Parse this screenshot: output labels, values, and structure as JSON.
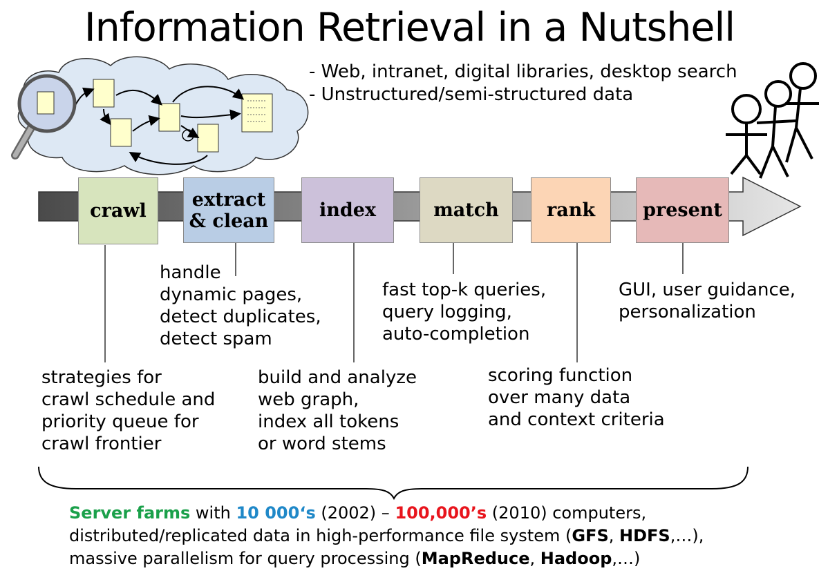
{
  "title": "Information Retrieval in a Nutshell",
  "bullets": [
    "- Web, intranet, digital libraries, desktop search",
    "- Unstructured/semi-structured data"
  ],
  "stages": {
    "crawl": {
      "label": "crawl",
      "color": "#d7e4bd"
    },
    "extract": {
      "line1": "extract",
      "line2": "& clean",
      "color": "#b9cde5"
    },
    "index": {
      "label": "index",
      "color": "#ccc1da"
    },
    "match": {
      "label": "match",
      "color": "#ddd9c3"
    },
    "rank": {
      "label": "rank",
      "color": "#fcd5b5"
    },
    "present": {
      "label": "present",
      "color": "#e6b9b8"
    }
  },
  "descriptions": {
    "extract": [
      "handle",
      "dynamic pages,",
      "detect duplicates,",
      "detect spam"
    ],
    "match": [
      "fast top-k queries,",
      "query logging,",
      "auto-completion"
    ],
    "present": [
      "GUI, user guidance,",
      "personalization"
    ],
    "crawl": [
      "strategies for",
      "crawl schedule and",
      "priority queue for",
      "crawl frontier"
    ],
    "index": [
      "build and analyze",
      "web graph,",
      "index all tokens",
      "or word stems"
    ],
    "rank": [
      "scoring function",
      "over many data",
      "and context criteria"
    ]
  },
  "footer": {
    "line1": {
      "server_farms": "Server farms",
      "with": " with ",
      "ten_k": "10 000‘s",
      "y2002": " (2002) – ",
      "hundred_k": "100,000’s",
      "y2010": " (2010) computers,"
    },
    "line2": {
      "pre": "distributed/replicated data in high-performance file system (",
      "gfs": "GFS",
      "sep": ", ",
      "hdfs": "HDFS",
      "post": ",…),"
    },
    "line3": {
      "pre": "massive parallelism for query processing (",
      "mapreduce": "MapReduce",
      "sep": ", ",
      "hadoop": "Hadoop",
      "post": ",…)"
    }
  },
  "colors": {
    "green": "#1aa04a",
    "blue": "#1f88c8",
    "red": "#e8141c",
    "cloud": "#dde8f4",
    "doc": "#ffffcc"
  },
  "icons": [
    "magnifier-icon",
    "document-icon",
    "stick-figure-icon",
    "cloud-icon",
    "arrow-icon",
    "brace-icon"
  ]
}
